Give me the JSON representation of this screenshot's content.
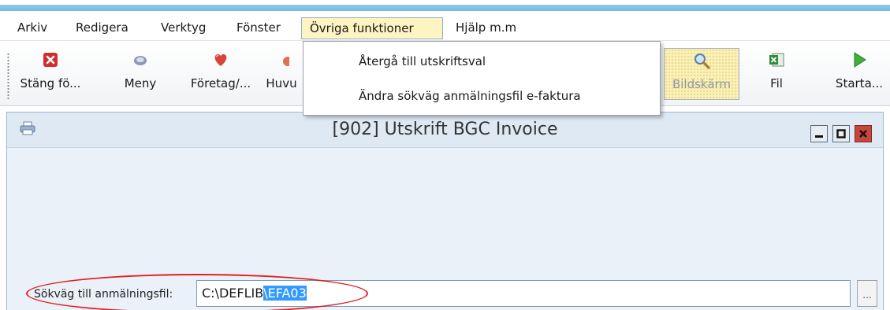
{
  "menubar": {
    "items": [
      {
        "label": "Arkiv"
      },
      {
        "label": "Redigera"
      },
      {
        "label": "Verktyg"
      },
      {
        "label": "Fönster"
      },
      {
        "label": "Övriga funktioner"
      },
      {
        "label": "Hjälp m.m"
      }
    ]
  },
  "toolbar": {
    "buttons": [
      {
        "label": "Stäng fö...",
        "icon": "close-x-icon"
      },
      {
        "label": "Meny",
        "icon": "menu-disc-icon"
      },
      {
        "label": "Företag/...",
        "icon": "heart-icon"
      },
      {
        "label": "Huvu",
        "icon": "partial-icon"
      },
      {
        "label": "Bildskärm",
        "icon": "magnifier-icon"
      },
      {
        "label": "Fil",
        "icon": "excel-icon"
      },
      {
        "label": "Starta...",
        "icon": "play-icon"
      }
    ]
  },
  "dropdown": {
    "items": [
      {
        "label": "Återgå till utskriftsval"
      },
      {
        "label": "Ändra sökväg anmälningsfil e-faktura"
      }
    ]
  },
  "window": {
    "title": "[902]  Utskrift BGC Invoice"
  },
  "path": {
    "label": "Sökväg till anmälningsfil:",
    "value_plain": "C:\\DEFLIB",
    "value_selected": "\\EFA03",
    "browse_label": "..."
  },
  "colors": {
    "accent_strip": "#72bde0",
    "menu_active": "#fdf4c2",
    "selection": "#3399ff",
    "annotation": "#e02020",
    "close_button": "#c8453b"
  }
}
